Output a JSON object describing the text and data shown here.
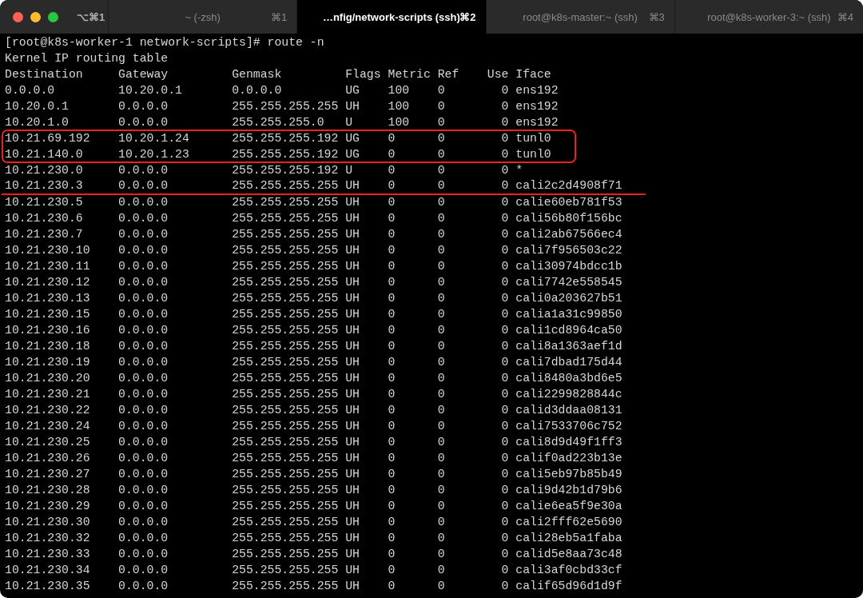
{
  "window": {
    "shortcut": "⌥⌘1"
  },
  "tabs": [
    {
      "label": "~ (-zsh)",
      "shortcut": "⌘1",
      "selected": false
    },
    {
      "label": "…nfig/network-scripts (ssh)",
      "shortcut": "⌘2",
      "selected": true
    },
    {
      "label": "root@k8s-master:~ (ssh)",
      "shortcut": "⌘3",
      "selected": false
    },
    {
      "label": "root@k8s-worker-3:~ (ssh)",
      "shortcut": "⌘4",
      "selected": false
    }
  ],
  "terminal": {
    "lines": [
      {
        "text": "[root@k8s-worker-1 network-scripts]# route -n"
      },
      {
        "text": "Kernel IP routing table"
      },
      {
        "text": "Destination     Gateway         Genmask         Flags Metric Ref    Use Iface"
      },
      {
        "text": "0.0.0.0         10.20.0.1       0.0.0.0         UG    100    0        0 ens192"
      },
      {
        "text": "10.20.0.1       0.0.0.0         255.255.255.255 UH    100    0        0 ens192"
      },
      {
        "text": "10.20.1.0       0.0.0.0         255.255.255.0   U     100    0        0 ens192"
      },
      {
        "text": "10.21.69.192    10.20.1.24      255.255.255.192 UG    0      0        0 tunl0",
        "boxed": true
      },
      {
        "text": "10.21.140.0     10.20.1.23      255.255.255.192 UG    0      0        0 tunl0",
        "boxed": true
      },
      {
        "text": "10.21.230.0     0.0.0.0         255.255.255.192 U     0      0        0 *"
      },
      {
        "text": "10.21.230.3     0.0.0.0         255.255.255.255 UH    0      0        0 cali2c2d4908f71",
        "underlined": true
      },
      {
        "text": "10.21.230.5     0.0.0.0         255.255.255.255 UH    0      0        0 calie60eb781f53"
      },
      {
        "text": "10.21.230.6     0.0.0.0         255.255.255.255 UH    0      0        0 cali56b80f156bc"
      },
      {
        "text": "10.21.230.7     0.0.0.0         255.255.255.255 UH    0      0        0 cali2ab67566ec4"
      },
      {
        "text": "10.21.230.10    0.0.0.0         255.255.255.255 UH    0      0        0 cali7f956503c22"
      },
      {
        "text": "10.21.230.11    0.0.0.0         255.255.255.255 UH    0      0        0 cali30974bdcc1b"
      },
      {
        "text": "10.21.230.12    0.0.0.0         255.255.255.255 UH    0      0        0 cali7742e558545"
      },
      {
        "text": "10.21.230.13    0.0.0.0         255.255.255.255 UH    0      0        0 cali0a203627b51"
      },
      {
        "text": "10.21.230.15    0.0.0.0         255.255.255.255 UH    0      0        0 calia1a31c99850"
      },
      {
        "text": "10.21.230.16    0.0.0.0         255.255.255.255 UH    0      0        0 cali1cd8964ca50"
      },
      {
        "text": "10.21.230.18    0.0.0.0         255.255.255.255 UH    0      0        0 cali8a1363aef1d"
      },
      {
        "text": "10.21.230.19    0.0.0.0         255.255.255.255 UH    0      0        0 cali7dbad175d44"
      },
      {
        "text": "10.21.230.20    0.0.0.0         255.255.255.255 UH    0      0        0 cali8480a3bd6e5"
      },
      {
        "text": "10.21.230.21    0.0.0.0         255.255.255.255 UH    0      0        0 cali2299828844c"
      },
      {
        "text": "10.21.230.22    0.0.0.0         255.255.255.255 UH    0      0        0 calid3ddaa08131"
      },
      {
        "text": "10.21.230.24    0.0.0.0         255.255.255.255 UH    0      0        0 cali7533706c752"
      },
      {
        "text": "10.21.230.25    0.0.0.0         255.255.255.255 UH    0      0        0 cali8d9d49f1ff3"
      },
      {
        "text": "10.21.230.26    0.0.0.0         255.255.255.255 UH    0      0        0 calif0ad223b13e"
      },
      {
        "text": "10.21.230.27    0.0.0.0         255.255.255.255 UH    0      0        0 cali5eb97b85b49"
      },
      {
        "text": "10.21.230.28    0.0.0.0         255.255.255.255 UH    0      0        0 cali9d42b1d79b6"
      },
      {
        "text": "10.21.230.29    0.0.0.0         255.255.255.255 UH    0      0        0 calie6ea5f9e30a"
      },
      {
        "text": "10.21.230.30    0.0.0.0         255.255.255.255 UH    0      0        0 cali2fff62e5690"
      },
      {
        "text": "10.21.230.32    0.0.0.0         255.255.255.255 UH    0      0        0 cali28eb5a1faba"
      },
      {
        "text": "10.21.230.33    0.0.0.0         255.255.255.255 UH    0      0        0 calid5e8aa73c48"
      },
      {
        "text": "10.21.230.34    0.0.0.0         255.255.255.255 UH    0      0        0 cali3af0cbd33cf"
      },
      {
        "text": "10.21.230.35    0.0.0.0         255.255.255.255 UH    0      0        0 calif65d96d1d9f"
      }
    ]
  }
}
